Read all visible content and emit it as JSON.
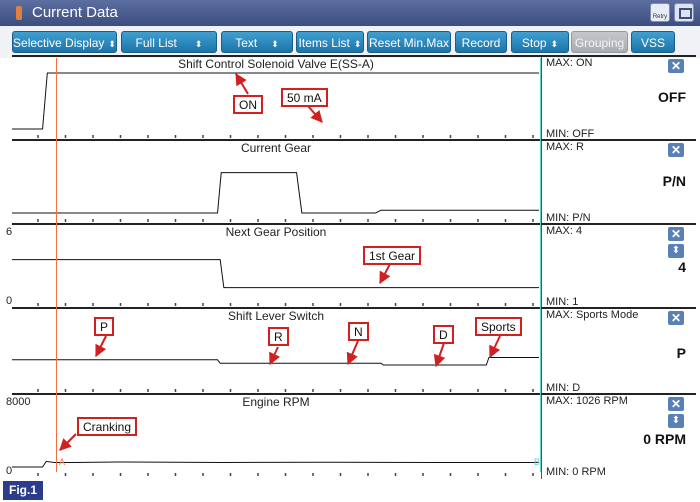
{
  "window": {
    "title": "Current Data",
    "retry_label": "Retry"
  },
  "toolbar": {
    "buttons": [
      {
        "label": "Selective Display",
        "dropdown": true
      },
      {
        "label": "Full List",
        "dropdown": true
      },
      {
        "label": "Text",
        "dropdown": true
      },
      {
        "label": "Items List",
        "dropdown": true
      },
      {
        "label": "Reset Min.Max",
        "dropdown": false
      },
      {
        "label": "Record",
        "dropdown": false
      },
      {
        "label": "Stop",
        "dropdown": true
      },
      {
        "label": "Grouping",
        "dropdown": false,
        "disabled": true
      },
      {
        "label": "VSS",
        "dropdown": false
      }
    ]
  },
  "panels": [
    {
      "title": "Shift Control Solenoid Valve E(SS-A)",
      "max": "MAX: ON",
      "min": "MIN: OFF",
      "value": "OFF",
      "y_top_label": "",
      "y_bottom_label": "",
      "trace": [
        [
          0,
          0.0
        ],
        [
          0.058,
          0.0
        ],
        [
          0.067,
          1.0
        ],
        [
          1.0,
          1.0
        ]
      ],
      "callouts": [
        {
          "text": "ON"
        },
        {
          "text": "50 mA"
        }
      ]
    },
    {
      "title": "Current Gear",
      "max": "MAX: R",
      "min": "MIN: P/N",
      "value": "P/N",
      "y_top_label": "",
      "y_bottom_label": "",
      "trace": [
        [
          0,
          0.0
        ],
        [
          0.39,
          0.0
        ],
        [
          0.397,
          0.72
        ],
        [
          0.54,
          0.72
        ],
        [
          0.55,
          0.0
        ],
        [
          0.69,
          0.0
        ],
        [
          0.7,
          0.05
        ],
        [
          1.0,
          0.05
        ]
      ],
      "callouts": []
    },
    {
      "title": "Next Gear Position",
      "max": "MAX:     4",
      "min": "MIN:     1",
      "value": "4",
      "y_top_label": "6",
      "y_bottom_label": "0",
      "trace": [
        [
          0,
          0.667
        ],
        [
          0.395,
          0.667
        ],
        [
          0.402,
          0.167
        ],
        [
          1.0,
          0.167
        ]
      ],
      "callouts": [
        {
          "text": "1st Gear"
        }
      ]
    },
    {
      "title": "Shift Lever Switch",
      "max": "MAX: Sports Mode",
      "min": "MIN: D",
      "value": "P",
      "y_top_label": "",
      "y_bottom_label": "",
      "trace": [
        [
          0,
          0.4
        ],
        [
          0.39,
          0.4
        ],
        [
          0.395,
          0.34
        ],
        [
          0.7,
          0.34
        ],
        [
          0.705,
          0.31
        ],
        [
          0.9,
          0.31
        ],
        [
          0.905,
          0.44
        ],
        [
          1.0,
          0.44
        ]
      ],
      "callouts": [
        {
          "text": "P"
        },
        {
          "text": "R"
        },
        {
          "text": "N"
        },
        {
          "text": "D"
        },
        {
          "text": "Sports"
        }
      ]
    },
    {
      "title": "Engine RPM",
      "max": "MAX:   1026 RPM",
      "min": "MIN:     0 RPM",
      "value": "0 RPM",
      "y_top_label": "8000",
      "y_bottom_label": "0",
      "trace": [
        [
          0,
          0.0
        ],
        [
          0.058,
          0.0
        ],
        [
          0.065,
          0.1
        ],
        [
          0.08,
          0.08
        ],
        [
          0.12,
          0.08
        ],
        [
          0.2,
          0.09
        ],
        [
          0.4,
          0.08
        ],
        [
          0.6,
          0.085
        ],
        [
          0.8,
          0.08
        ],
        [
          1.0,
          0.08
        ]
      ],
      "callouts": [
        {
          "text": "Cranking"
        }
      ]
    }
  ],
  "cursors": {
    "a_label": "A",
    "b_label": "B"
  },
  "figure_label": "Fig.1",
  "colors": {
    "titlebar": "#3c4d80",
    "toolbar_button": "#1d74a8",
    "callout_border": "#d02020",
    "cursor_a": "#f07040",
    "cursor_b": "#60d0d0"
  }
}
